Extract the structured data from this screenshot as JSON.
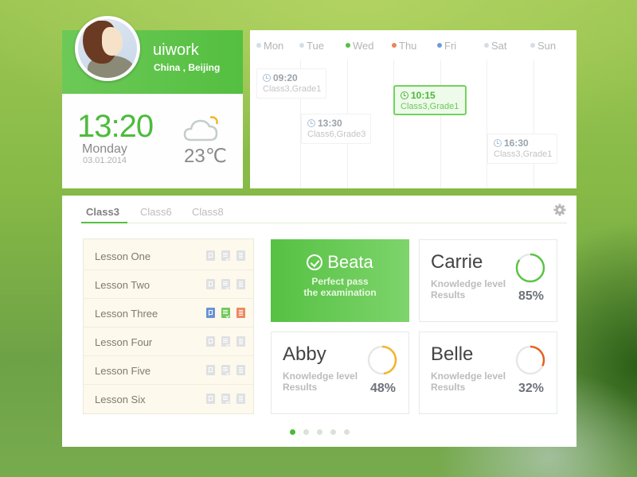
{
  "profile": {
    "name": "uiwork",
    "location": "China , Beijing",
    "avatar": "avatar-portrait"
  },
  "clock": {
    "time": "13:20",
    "day": "Monday",
    "date": "03.01.2014"
  },
  "weather": {
    "icon": "partly-cloudy-icon",
    "temperature": "23℃"
  },
  "calendar": {
    "days": [
      {
        "label": "Mon",
        "dot_color": "#d5dde6"
      },
      {
        "label": "Tue",
        "dot_color": "#d5dde6"
      },
      {
        "label": "Wed",
        "dot_color": "#55c045"
      },
      {
        "label": "Thu",
        "dot_color": "#ea8559"
      },
      {
        "label": "Fri",
        "dot_color": "#6a9be3"
      },
      {
        "label": "Sat",
        "dot_color": "#d5dde6"
      },
      {
        "label": "Sun",
        "dot_color": "#d5dde6"
      }
    ],
    "events": [
      {
        "time": "09:20",
        "class": "Class3,Grade1",
        "day": "Mon",
        "active": false
      },
      {
        "time": "13:30",
        "class": "Class6,Grade3",
        "day": "Tue",
        "active": false
      },
      {
        "time": "10:15",
        "class": "Class3,Grade1",
        "day": "Thu",
        "active": true
      },
      {
        "time": "16:30",
        "class": "Class3,Grade1",
        "day": "Sat",
        "active": false
      }
    ]
  },
  "tabs": [
    {
      "label": "Class3",
      "active": true
    },
    {
      "label": "Class6",
      "active": false
    },
    {
      "label": "Class8",
      "active": false
    }
  ],
  "settings_icon": "gear-icon",
  "lessons": [
    {
      "name": "Lesson One",
      "active": false
    },
    {
      "name": "Lesson Two",
      "active": false
    },
    {
      "name": "Lesson Three",
      "active": true
    },
    {
      "name": "Lesson Four",
      "active": false
    },
    {
      "name": "Lesson Five",
      "active": false
    },
    {
      "name": "Lesson Six",
      "active": false
    }
  ],
  "lesson_icons": [
    "preview-doc-icon",
    "checked-doc-icon",
    "list-doc-icon"
  ],
  "pass_card": {
    "name": "Beata",
    "line1": "Perfect pass",
    "line2": "the examination"
  },
  "students": [
    {
      "name": "Carrie",
      "sub1": "Knowledge level",
      "sub2": "Results",
      "percent": 85,
      "percent_label": "85%",
      "color": "#5cc447"
    },
    {
      "name": "Abby",
      "sub1": "Knowledge level",
      "sub2": "Results",
      "percent": 48,
      "percent_label": "48%",
      "color": "#f2b52a"
    },
    {
      "name": "Belle",
      "sub1": "Knowledge level",
      "sub2": "Results",
      "percent": 32,
      "percent_label": "32%",
      "color": "#e5621f"
    }
  ],
  "pagination": {
    "count": 5,
    "current": 1
  },
  "colors": {
    "accent": "#55bf43",
    "ring_track": "#e6e8e6"
  }
}
